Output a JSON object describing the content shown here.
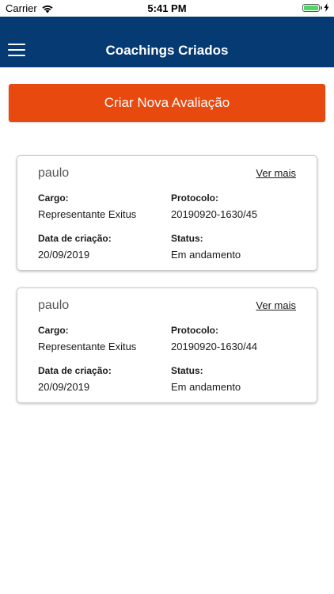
{
  "status_bar": {
    "carrier": "Carrier",
    "time": "5:41 PM"
  },
  "header": {
    "title": "Coachings Criados"
  },
  "actions": {
    "create_label": "Criar Nova Avaliação"
  },
  "cards": [
    {
      "name": "paulo",
      "link_label": "Ver mais",
      "cargo_label": "Cargo:",
      "cargo_value": "Representante Exitus",
      "protocolo_label": "Protocolo:",
      "protocolo_value": "20190920-1630/45",
      "data_label": "Data de criação:",
      "data_value": "20/09/2019",
      "status_label": "Status:",
      "status_value": "Em andamento"
    },
    {
      "name": "paulo",
      "link_label": "Ver mais",
      "cargo_label": "Cargo:",
      "cargo_value": "Representante Exitus",
      "protocolo_label": "Protocolo:",
      "protocolo_value": "20190920-1630/44",
      "data_label": "Data de criação:",
      "data_value": "20/09/2019",
      "status_label": "Status:",
      "status_value": "Em andamento"
    }
  ],
  "colors": {
    "header_bg": "#053a73",
    "accent": "#e8490f",
    "battery": "#4cd964"
  },
  "icons": {
    "menu": "hamburger-menu-icon",
    "wifi": "wifi-icon",
    "battery": "battery-icon",
    "charging": "lightning-bolt-icon"
  }
}
